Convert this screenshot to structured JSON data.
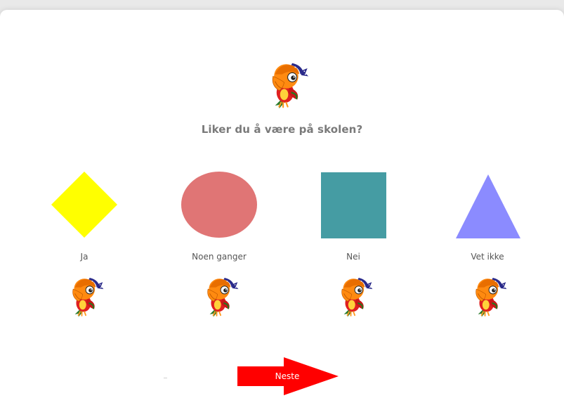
{
  "question": {
    "text": "Liker du å være på skolen?"
  },
  "options": [
    {
      "label": "Ja",
      "shape": "diamond-icon",
      "color": "#ffff00"
    },
    {
      "label": "Noen ganger",
      "shape": "circle-icon",
      "color": "#e07575"
    },
    {
      "label": "Nei",
      "shape": "square-icon",
      "color": "#459ca3"
    },
    {
      "label": "Vet ikke",
      "shape": "triangle-icon",
      "color": "#8b8bff"
    }
  ],
  "next_button": {
    "label": "Neste",
    "color": "#ff0000"
  },
  "mascot": {
    "icon": "parrot-icon"
  }
}
